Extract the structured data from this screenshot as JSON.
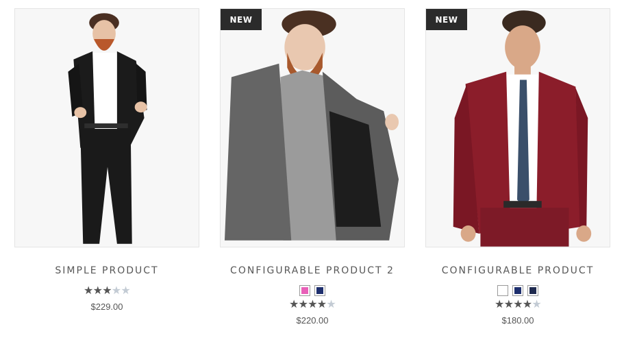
{
  "products": [
    {
      "name": "SIMPLE PRODUCT",
      "badge": "",
      "rating": 3,
      "rating_max": 5,
      "swatches": [],
      "price": "$229.00"
    },
    {
      "name": "CONFIGURABLE PRODUCT 2",
      "badge": "NEW",
      "rating": 4,
      "rating_max": 5,
      "swatches": [
        "#e860b8",
        "#1e2f6e"
      ],
      "price": "$220.00"
    },
    {
      "name": "CONFIGURABLE PRODUCT",
      "badge": "NEW",
      "rating": 4,
      "rating_max": 5,
      "swatches": [
        "#ffffff",
        "#1e2f6e",
        "#1f2a4f"
      ],
      "price": "$180.00"
    }
  ],
  "colors": {
    "badge_bg": "#2b2b2b",
    "star_on": "#555555",
    "star_off": "#c3cbd4"
  }
}
